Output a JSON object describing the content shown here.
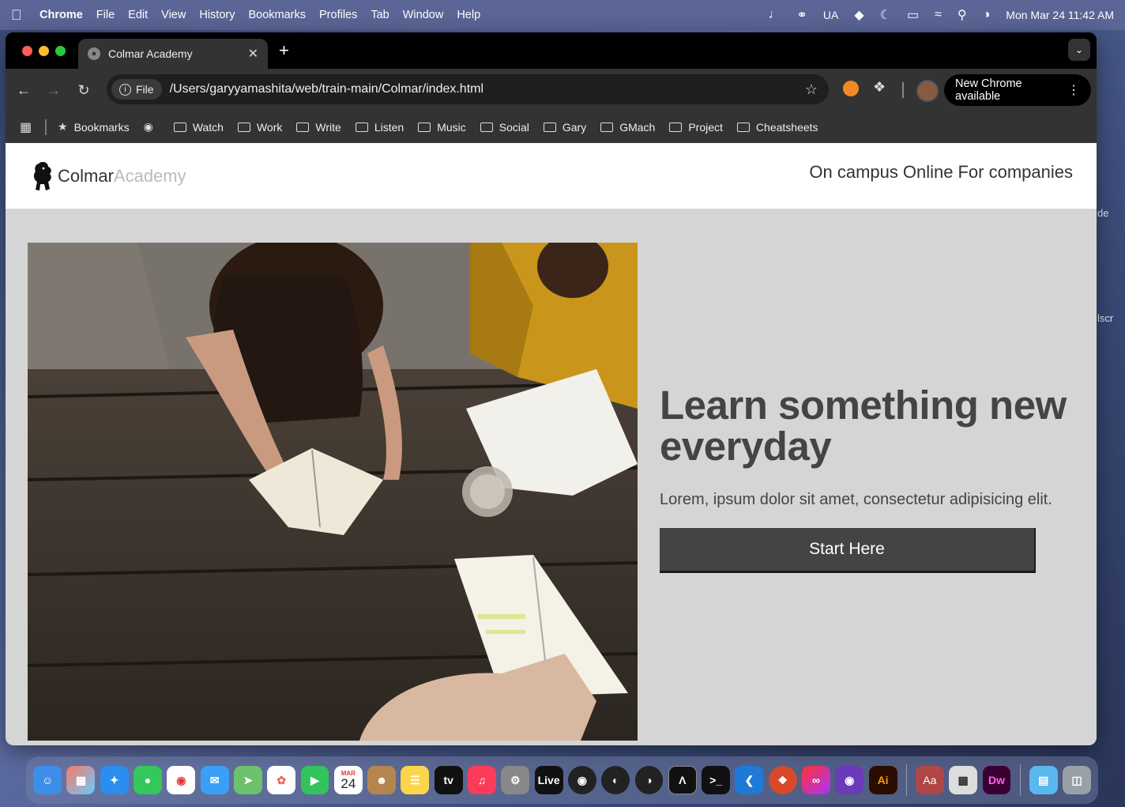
{
  "menubar": {
    "app": "Chrome",
    "items": [
      "File",
      "Edit",
      "View",
      "History",
      "Bookmarks",
      "Profiles",
      "Tab",
      "Window",
      "Help"
    ],
    "status_ua": "UA",
    "datetime": "Mon Mar 24  11:42 AM"
  },
  "desktop": {
    "label_top": "de",
    "label_mid": "lscr"
  },
  "browser": {
    "tab_title": "Colmar Academy",
    "omnibox_chip": "File",
    "url": "/Users/garyyamashita/web/train-main/Colmar/index.html",
    "update_label": "New Chrome available",
    "bookmarks": [
      "Bookmarks",
      "Watch",
      "Work",
      "Write",
      "Listen",
      "Music",
      "Social",
      "Gary",
      "GMach",
      "Project",
      "Cheatsheets"
    ]
  },
  "site": {
    "brand_primary": "Colmar",
    "brand_secondary": "Academy",
    "nav": [
      "On campus",
      "Online",
      "For companies"
    ],
    "hero_title": "Learn something new everyday",
    "hero_sub": "Lorem, ipsum dolor sit amet, consectetur adipisicing elit.",
    "cta": "Start Here"
  },
  "dock": {
    "calendar_month": "MAR",
    "calendar_day": "24",
    "live_label": "Live",
    "tv_label": "tv",
    "ai_label": "Ai",
    "dict_label": "Aa",
    "dw_label": "Dw"
  },
  "colors": {
    "accent_button": "#444444",
    "page_bg": "#d5d5d5",
    "brand_secondary": "#bbbbbb"
  }
}
